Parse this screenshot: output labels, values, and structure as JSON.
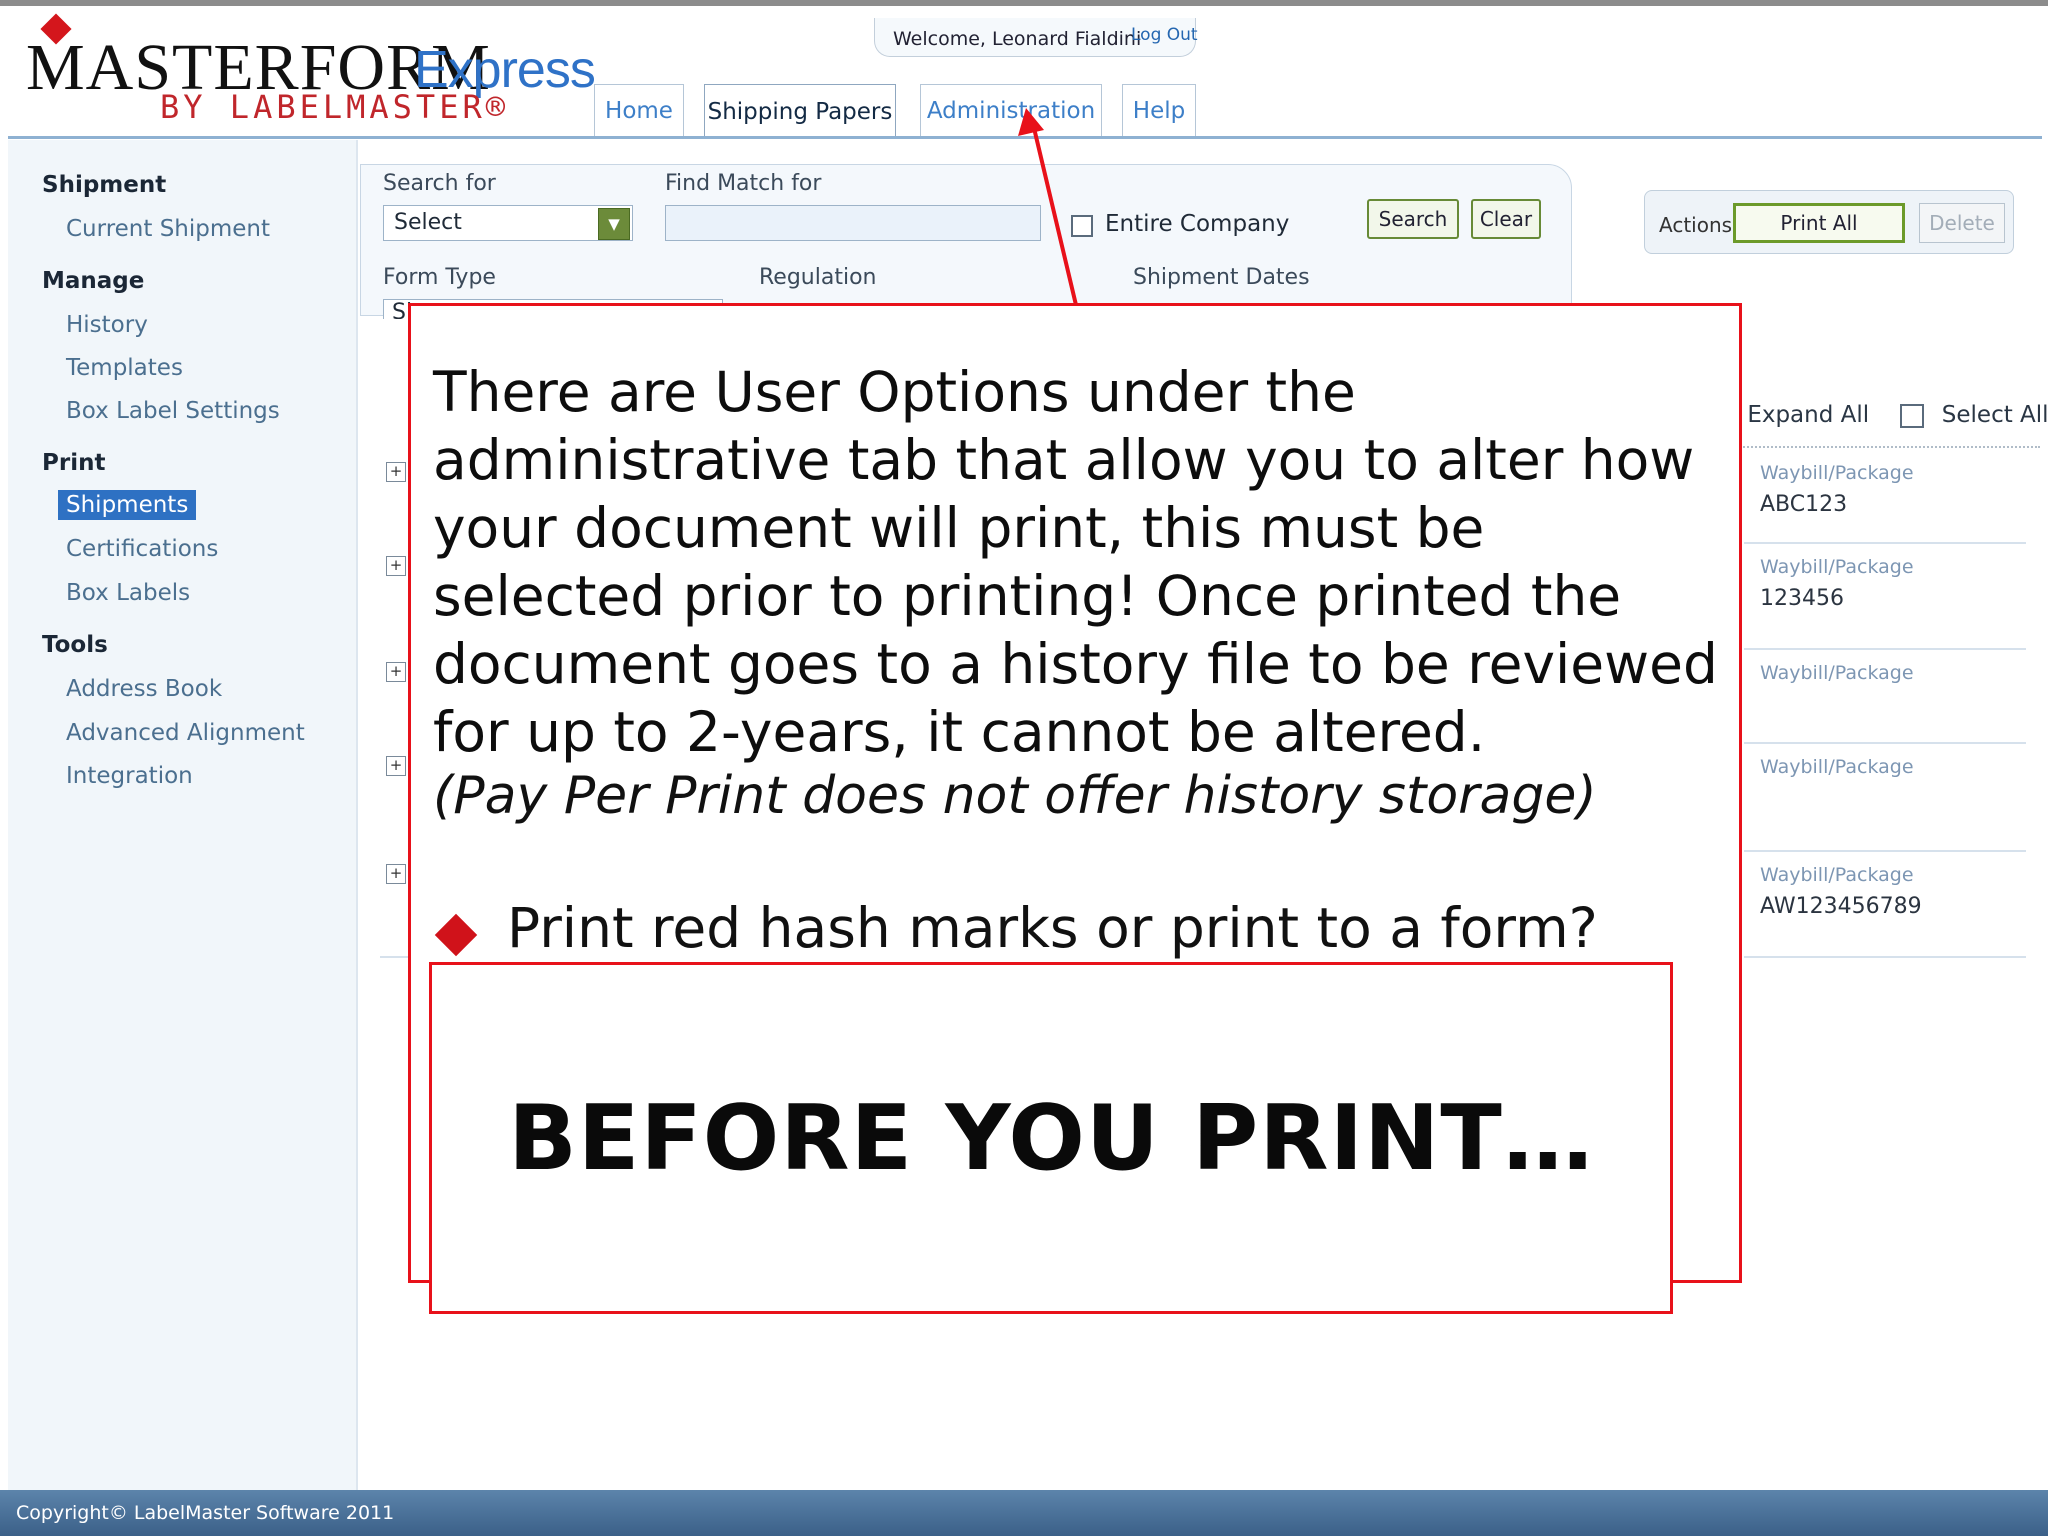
{
  "header": {
    "logo_master": "MASTERFORM",
    "logo_express": "Express",
    "logo_by": "BY LABELMASTER®",
    "welcome": "Welcome, Leonard Fialdini",
    "logout": "Log Out"
  },
  "tabs": [
    {
      "label": "Home"
    },
    {
      "label": "Shipping Papers",
      "active": true
    },
    {
      "label": "Administration"
    },
    {
      "label": "Help"
    }
  ],
  "sidebar": {
    "sections": [
      {
        "title": "Shipment",
        "items": [
          "Current Shipment"
        ]
      },
      {
        "title": "Manage",
        "items": [
          "History",
          "Templates",
          "Box Label Settings"
        ]
      },
      {
        "title": "Print",
        "items": [
          "Shipments",
          "Certifications",
          "Box Labels"
        ],
        "selected": "Shipments"
      },
      {
        "title": "Tools",
        "items": [
          "Address Book",
          "Advanced Alignment",
          "Integration"
        ]
      }
    ]
  },
  "search": {
    "search_for_label": "Search for",
    "search_for_value": "Select",
    "find_match_label": "Find Match for",
    "entire_company_label": "Entire Company",
    "search_button": "Search",
    "clear_button": "Clear",
    "form_type_label": "Form Type",
    "form_type_partial": "Sl",
    "regulation_label": "Regulation",
    "shipment_dates_label": "Shipment Dates"
  },
  "actions": {
    "label": "Actions",
    "print_all": "Print All",
    "delete": "Delete"
  },
  "list": {
    "expand_all": "Expand All",
    "select_all": "Select All",
    "rows": [
      {
        "label": "Waybill/Package",
        "value": "ABC123"
      },
      {
        "label": "Waybill/Package",
        "value": "123456"
      },
      {
        "label": "Waybill/Package",
        "value": ""
      },
      {
        "label": "Waybill/Package",
        "value": ""
      },
      {
        "label": "Waybill/Package",
        "value": "AW123456789"
      }
    ]
  },
  "callout": {
    "text": "There are User Options under the administrative tab that allow you to alter how your document will print, this must be selected prior to printing!  Once printed the document goes to a history file to be reviewed for up to 2-years, it cannot be altered.",
    "note": "(Pay Per Print does not offer history storage)",
    "bullet": "Print red hash marks or print to a form?",
    "banner": "BEFORE YOU PRINT…"
  },
  "footer": {
    "copyright": "Copyright© LabelMaster Software 2011"
  },
  "colors": {
    "accent_blue": "#2e71c3",
    "callout_red": "#e8111a",
    "button_green": "#678a36"
  }
}
